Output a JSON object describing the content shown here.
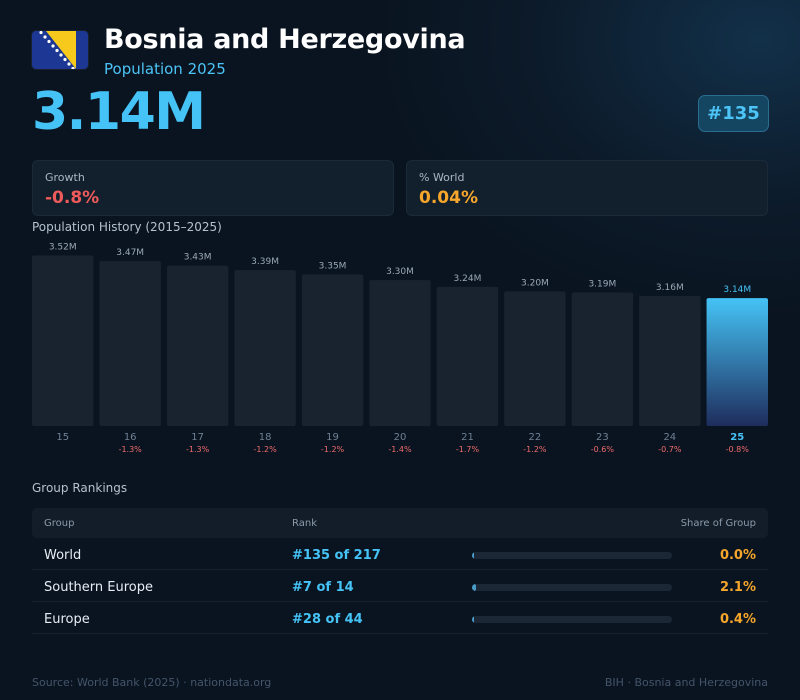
{
  "header": {
    "country": "Bosnia and Herzegovina",
    "subtitle": "Population 2025",
    "population": "3.14M",
    "rank_badge": "#135",
    "flag_icon": "bosnia-herzegovina-flag-icon"
  },
  "stats": {
    "growth": {
      "label": "Growth",
      "value": "-0.8%",
      "color": "#ef5b5b"
    },
    "world": {
      "label": "% World",
      "value": "0.04%",
      "color": "#f5a62b"
    }
  },
  "history_title": "Population History (2015–2025)",
  "chart_data": {
    "type": "bar",
    "title": "Population History (2015–2025)",
    "categories": [
      "15",
      "16",
      "17",
      "18",
      "19",
      "20",
      "21",
      "22",
      "23",
      "24",
      "25"
    ],
    "values": [
      3.52,
      3.47,
      3.43,
      3.39,
      3.35,
      3.3,
      3.24,
      3.2,
      3.19,
      3.16,
      3.14
    ],
    "value_labels": [
      "3.52M",
      "3.47M",
      "3.43M",
      "3.39M",
      "3.35M",
      "3.30M",
      "3.24M",
      "3.20M",
      "3.19M",
      "3.16M",
      "3.14M"
    ],
    "growth_labels": [
      "",
      "-1.3%",
      "-1.3%",
      "-1.2%",
      "-1.2%",
      "-1.4%",
      "-1.7%",
      "-1.2%",
      "-0.6%",
      "-0.7%",
      "-0.8%"
    ],
    "highlight_index": 10,
    "unit": "M",
    "grid": false,
    "colors": {
      "bar": "#18232f",
      "highlight_top": "#45c3f6",
      "highlight_bottom": "#1e2d5c",
      "growth": "#ef6b6b",
      "tick": "#6f8092",
      "highlight_tick": "#45c3f6"
    }
  },
  "rankings": {
    "title": "Group Rankings",
    "columns": [
      "Group",
      "Rank",
      "Share of Group"
    ],
    "rows": [
      {
        "group": "World",
        "rank": "#135 of 217",
        "share": "0.0%",
        "share_value": 0.0
      },
      {
        "group": "Southern Europe",
        "rank": "#7 of 14",
        "share": "2.1%",
        "share_value": 2.1
      },
      {
        "group": "Europe",
        "rank": "#28 of 44",
        "share": "0.4%",
        "share_value": 0.4
      }
    ]
  },
  "footer": {
    "source": "Source: World Bank (2025) · nationdata.org",
    "right": "BIH · Bosnia and Herzegovina"
  }
}
